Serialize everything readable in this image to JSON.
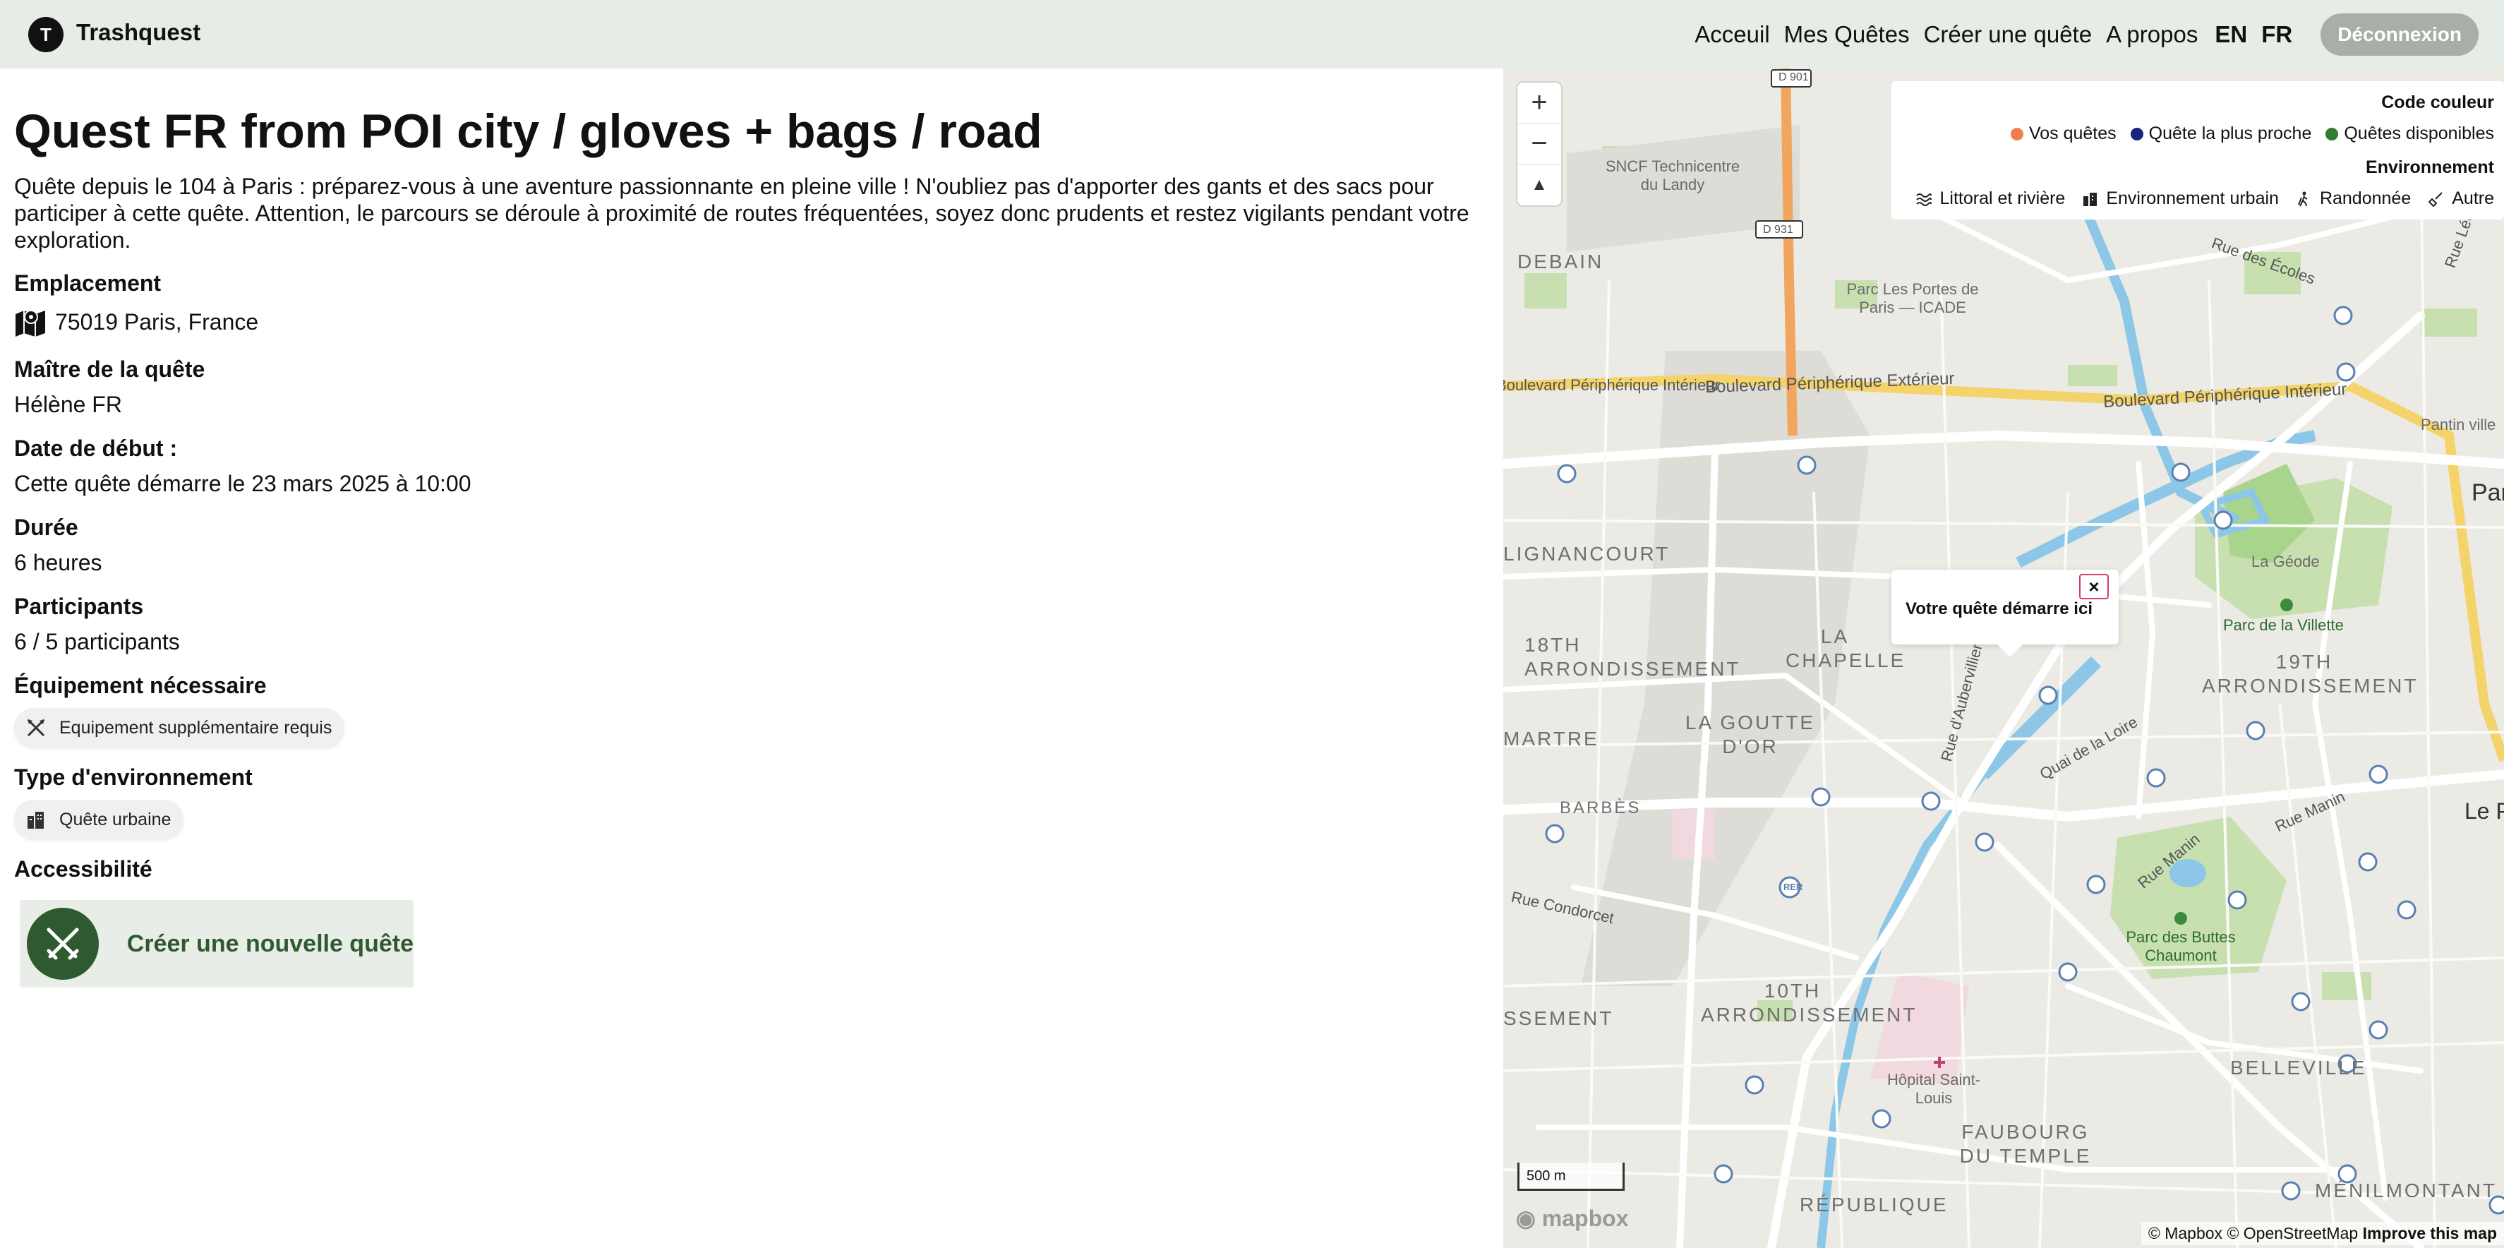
{
  "header": {
    "logo_letter": "T",
    "brand": "Trashquest",
    "nav": [
      "Acceuil",
      "Mes Quêtes",
      "Créer une quête",
      "A propos"
    ],
    "lang_en": "EN",
    "lang_fr": "FR",
    "logout": "Déconnexion"
  },
  "quest": {
    "title": "Quest FR from POI city / gloves + bags / road",
    "description": "Quête depuis le 104 à Paris : préparez-vous à une aventure passionnante en pleine ville ! N'oubliez pas d'apporter des gants et des sacs pour participer à cette quête. Attention, le parcours se déroule à proximité de routes fréquentées, soyez donc prudents et restez vigilants pendant votre exploration.",
    "location_label": "Emplacement",
    "location_value": "75019 Paris, France",
    "master_label": "Maître de la quête",
    "master_value": "Hélène FR",
    "start_label": "Date de début :",
    "start_value": "Cette quête démarre le 23 mars 2025 à 10:00",
    "duration_label": "Durée",
    "duration_value": "6 heures",
    "participants_label": "Participants",
    "participants_value": "6 / 5 participants",
    "equipment_label": "Équipement nécessaire",
    "equipment_chip": "Equipement supplémentaire requis",
    "environment_label": "Type d'environnement",
    "environment_chip": "Quête urbaine",
    "accessibility_label": "Accessibilité",
    "create_button": "Créer une nouvelle quête"
  },
  "map": {
    "zoom_in": "+",
    "zoom_out": "−",
    "compass": "▲",
    "legend": {
      "color_title": "Code couleur",
      "colors": [
        {
          "label": "Vos quêtes",
          "color": "#f07f4f"
        },
        {
          "label": "Quête la plus proche",
          "color": "#1a237e"
        },
        {
          "label": "Quêtes disponibles",
          "color": "#2e7d32"
        }
      ],
      "env_title": "Environnement",
      "envs": [
        "Littoral et rivière",
        "Environnement urbain",
        "Randonnée",
        "Autre"
      ]
    },
    "popup_text": "Votre quête démarre ici",
    "popup_close": "×",
    "scale": "500 m",
    "mapbox_logo": "mapbox",
    "attribution_1": "© Mapbox",
    "attribution_2": "© OpenStreetMap",
    "attribution_3": "Improve this map",
    "labels": {
      "d901": "D 901",
      "d931": "D 931",
      "sncf": "SNCF Technicentre du Landy",
      "debain": "DEBAIN",
      "parc_portes": "Parc Les Portes de Paris — ICADE",
      "bd_peri_interieur_left": "Boulevard Périphérique Intérieur",
      "bd_peri_exterieur": "Boulevard Périphérique Extérieur",
      "bd_peri_interieur_right": "Boulevard Périphérique Intérieur",
      "rue_des_ecoles": "Rue des Écoles",
      "rue_lecuyer": "Rue Lécuyer",
      "pantin_ville": "Pantin ville",
      "par": "Par",
      "lignancourt": "LIGNANCOURT",
      "la_geode": "La Géode",
      "parc_villette": "Parc de la Villette",
      "arr18": "18TH ARRONDISSEMENT",
      "la_chapelle": "LA CHAPELLE",
      "arr19": "19TH ARRONDISSEMENT",
      "rue_aubervilliers": "Rue d'Aubervilliers",
      "quai_loire": "Quai de la Loire",
      "montmartre": "MARTRE",
      "goutte_dor": "LA GOUTTE D'OR",
      "barbes": "BARBÈS",
      "rue_manin_right": "Rue Manin",
      "le_p": "Le P",
      "rue_condorcet": "Rue Condorcet",
      "rue_manin_mid": "Rue Manin",
      "buttes_chaumont": "Parc des Buttes Chaumont",
      "arr10": "10TH ARRONDISSEMENT",
      "ssement": "SSEMENT",
      "hopital": "Hôpital Saint-Louis",
      "belleville": "BELLEVILLE",
      "faubourg": "FAUBOURG DU TEMPLE",
      "republique": "RÉPUBLIQUE",
      "menilmontant": "MÉNILMONTANT",
      "rer": "RER"
    }
  }
}
